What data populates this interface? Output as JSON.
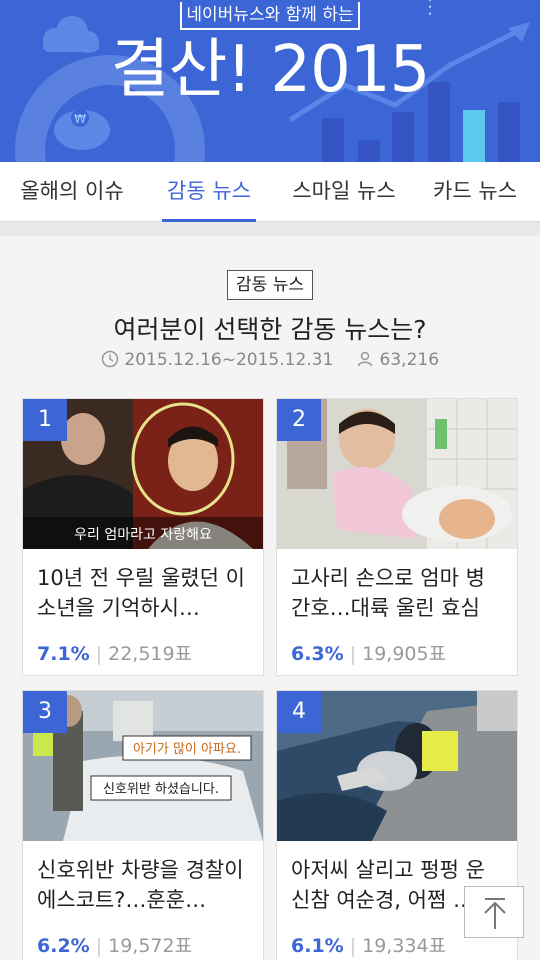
{
  "banner": {
    "subtitle": "네이버뉴스와 함께 하는",
    "title": "결산! 2015"
  },
  "tabs": [
    {
      "label": "올해의 이슈"
    },
    {
      "label": "감동 뉴스"
    },
    {
      "label": "스마일 뉴스"
    },
    {
      "label": "카드 뉴스"
    }
  ],
  "section": {
    "tag": "감동 뉴스",
    "headline": "여러분이 선택한 감동 뉴스는?",
    "period": "2015.12.16~2015.12.31",
    "participants": "63,216"
  },
  "cards": [
    {
      "rank": "1",
      "title": "10년 전 우릴 울렸던 이 소년을 기억하시…",
      "percent": "7.1%",
      "votes": "22,519표",
      "caption": "우리 엄마라고 자랑해요"
    },
    {
      "rank": "2",
      "title": "고사리 손으로 엄마 병 간호…대륙 울린 효심",
      "percent": "6.3%",
      "votes": "19,905표"
    },
    {
      "rank": "3",
      "title": "신호위반 차량을 경찰이 에스코트?…훈훈…",
      "percent": "6.2%",
      "votes": "19,572표",
      "caption1": "아기가 많이 아파요.",
      "caption2": "신호위반 하셨습니다."
    },
    {
      "rank": "4",
      "title": "아저씨 살리고 펑펑 운 신참 여순경, 어쩜 …",
      "percent": "6.1%",
      "votes": "19,334표"
    }
  ],
  "colors": {
    "accent": "#3c66d6"
  },
  "icons": {
    "period": "clock-icon",
    "participants": "person-icon",
    "scroll_top": "arrow-up-icon"
  }
}
